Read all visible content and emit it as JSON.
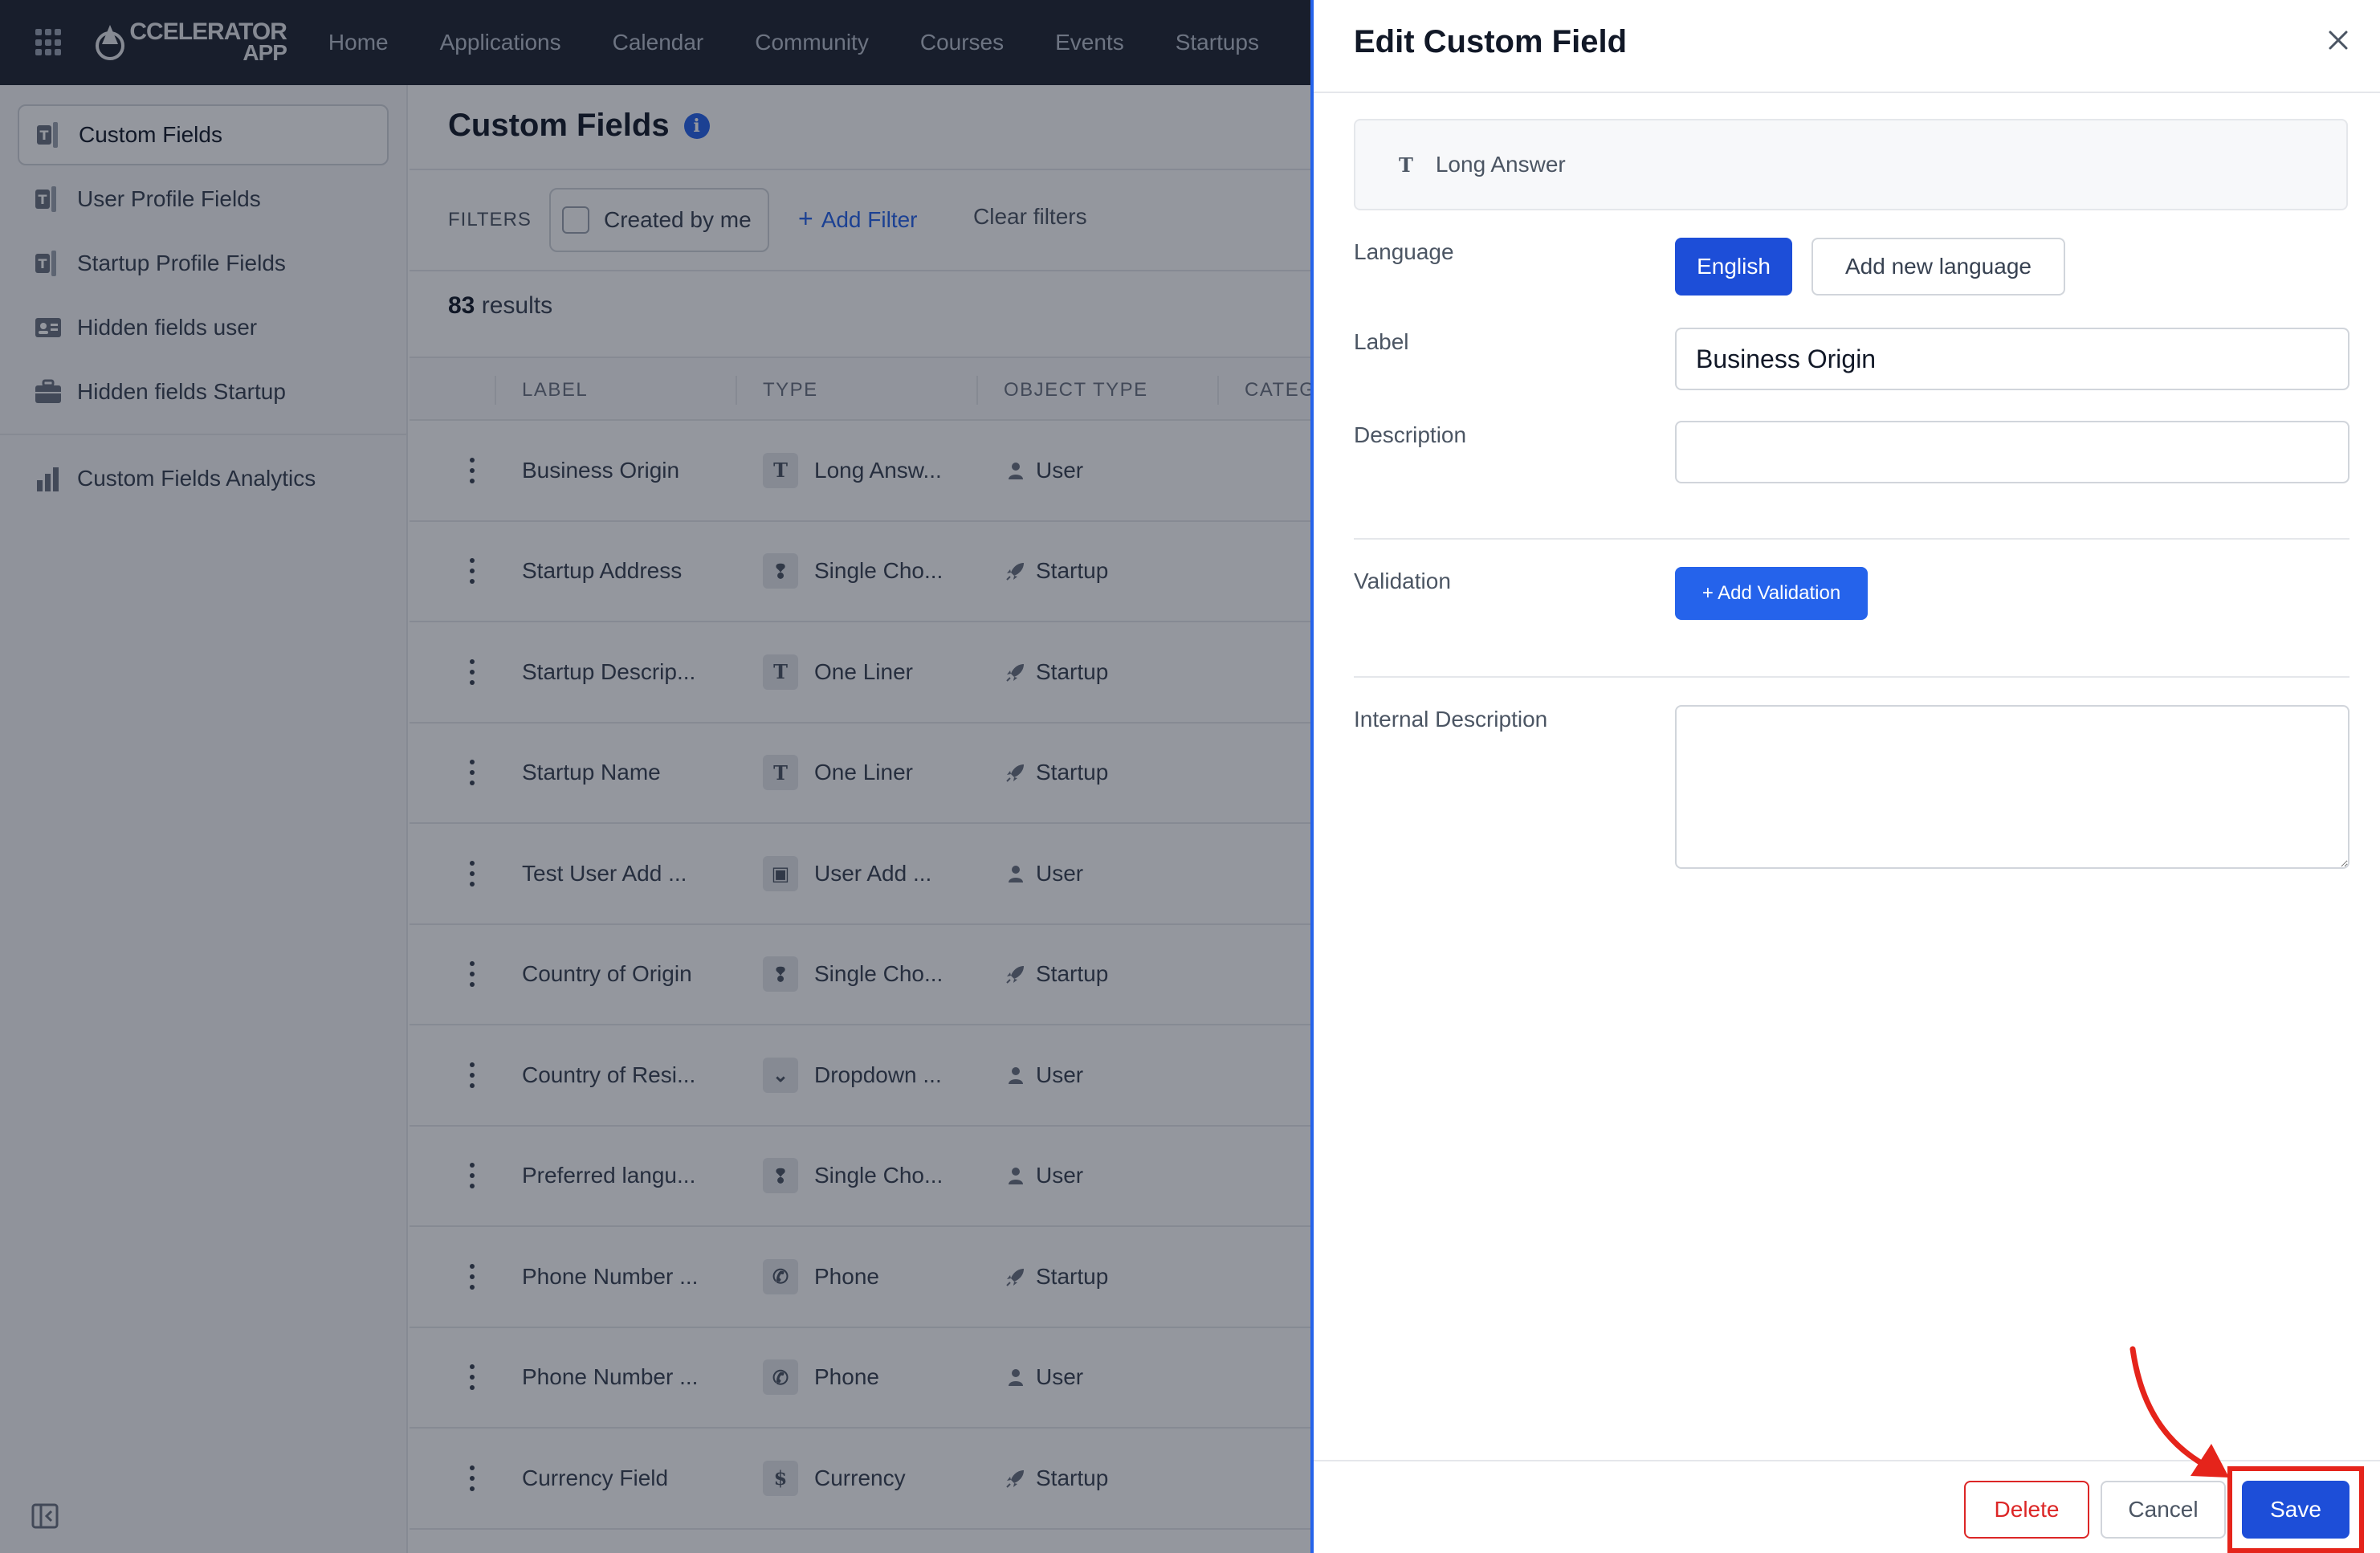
{
  "app": {
    "logo_line1": "CCELERATOR",
    "logo_line2": "APP"
  },
  "nav": [
    "Home",
    "Applications",
    "Calendar",
    "Community",
    "Courses",
    "Events",
    "Startups"
  ],
  "sidebar": {
    "items": [
      {
        "label": "Custom Fields",
        "icon": "custom-fields-icon",
        "active": true
      },
      {
        "label": "User Profile Fields",
        "icon": "custom-fields-icon"
      },
      {
        "label": "Startup Profile Fields",
        "icon": "custom-fields-icon"
      },
      {
        "label": "Hidden fields user",
        "icon": "id-card-icon"
      },
      {
        "label": "Hidden fields Startup",
        "icon": "briefcase-icon"
      },
      {
        "label": "Custom Fields Analytics",
        "icon": "bar-chart-icon"
      }
    ]
  },
  "main": {
    "title": "Custom Fields",
    "filters_label": "FILTERS",
    "created_by_me": "Created by me",
    "add_filter": "Add Filter",
    "clear_filters": "Clear filters",
    "results_count": "83",
    "results_text": " results",
    "columns": [
      "LABEL",
      "TYPE",
      "OBJECT TYPE",
      "CATEG"
    ],
    "rows": [
      {
        "label": "Business Origin",
        "type": "Long Answ...",
        "type_icon": "T",
        "object": "User"
      },
      {
        "label": "Startup Address",
        "type": "Single Cho...",
        "type_icon": "❢",
        "object": "Startup"
      },
      {
        "label": "Startup Descrip...",
        "type": "One Liner",
        "type_icon": "T",
        "object": "Startup"
      },
      {
        "label": "Startup Name",
        "type": "One Liner",
        "type_icon": "T",
        "object": "Startup"
      },
      {
        "label": "Test User Add ...",
        "type": "User Add ...",
        "type_icon": "▣",
        "object": "User"
      },
      {
        "label": "Country of Origin",
        "type": "Single Cho...",
        "type_icon": "❢",
        "object": "Startup"
      },
      {
        "label": "Country of Resi...",
        "type": "Dropdown ...",
        "type_icon": "⌄",
        "object": "User"
      },
      {
        "label": "Preferred langu...",
        "type": "Single Cho...",
        "type_icon": "❢",
        "object": "User"
      },
      {
        "label": "Phone Number ...",
        "type": "Phone",
        "type_icon": "✆",
        "object": "Startup"
      },
      {
        "label": "Phone Number ...",
        "type": "Phone",
        "type_icon": "✆",
        "object": "User"
      },
      {
        "label": "Currency Field",
        "type": "Currency",
        "type_icon": "$",
        "object": "Startup"
      }
    ]
  },
  "drawer": {
    "title": "Edit Custom Field",
    "field_type": "Long Answer",
    "language_label": "Language",
    "language_selected": "English",
    "add_language": "Add new language",
    "label_label": "Label",
    "label_value": "Business Origin",
    "description_label": "Description",
    "description_value": "",
    "validation_label": "Validation",
    "add_validation": "+ Add Validation",
    "internal_description_label": "Internal Description",
    "internal_description_value": "",
    "delete": "Delete",
    "cancel": "Cancel",
    "save": "Save"
  },
  "colors": {
    "accent": "#1d4ed8",
    "danger": "#dc2626",
    "highlight": "#e5241b",
    "nav_bg": "#1e2431"
  }
}
